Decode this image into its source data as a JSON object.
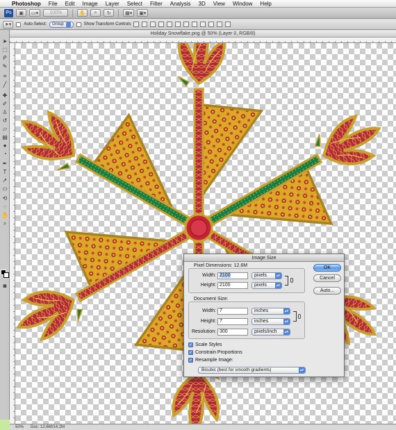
{
  "menubar": {
    "app_name": "Photoshop",
    "items": [
      "File",
      "Edit",
      "Image",
      "Layer",
      "Select",
      "Filter",
      "Analysis",
      "3D",
      "View",
      "Window",
      "Help"
    ]
  },
  "appbar": {
    "logo": "Ps",
    "zoom": "100%"
  },
  "options_bar": {
    "auto_select_label": "Auto-Select:",
    "auto_select_value": "Group",
    "transform_controls_label": "Show Transform Controls"
  },
  "document": {
    "title": "Holiday Snowflake.png @ 50% (Layer 0, RGB/8)"
  },
  "statusbar": {
    "zoom": "50%",
    "doc_info": "Doc: 12.6M/14.2M"
  },
  "dialog": {
    "title": "Image Size",
    "pixel_dimensions_label": "Pixel Dimensions:",
    "pixel_dimensions_size": "12.6M",
    "width_label": "Width:",
    "height_label": "Height:",
    "pixel_width": "2100",
    "pixel_height": "2100",
    "pixel_width_unit": "pixels",
    "pixel_height_unit": "pixels",
    "document_size_label": "Document Size:",
    "doc_width": "7",
    "doc_height": "7",
    "doc_width_unit": "inches",
    "doc_height_unit": "inches",
    "resolution_label": "Resolution:",
    "resolution": "300",
    "resolution_unit": "pixels/inch",
    "scale_styles": "Scale Styles",
    "constrain_proportions": "Constrain Proportions",
    "resample_image": "Resample Image:",
    "resample_method": "Bicubic (best for smooth gradients)",
    "ok_button": "OK",
    "cancel_button": "Cancel",
    "auto_button": "Auto..."
  },
  "colors": {
    "gold": "#d4a52a",
    "red": "#a8162a",
    "green": "#1f7a3c",
    "accent_blue": "#4f86d8"
  }
}
